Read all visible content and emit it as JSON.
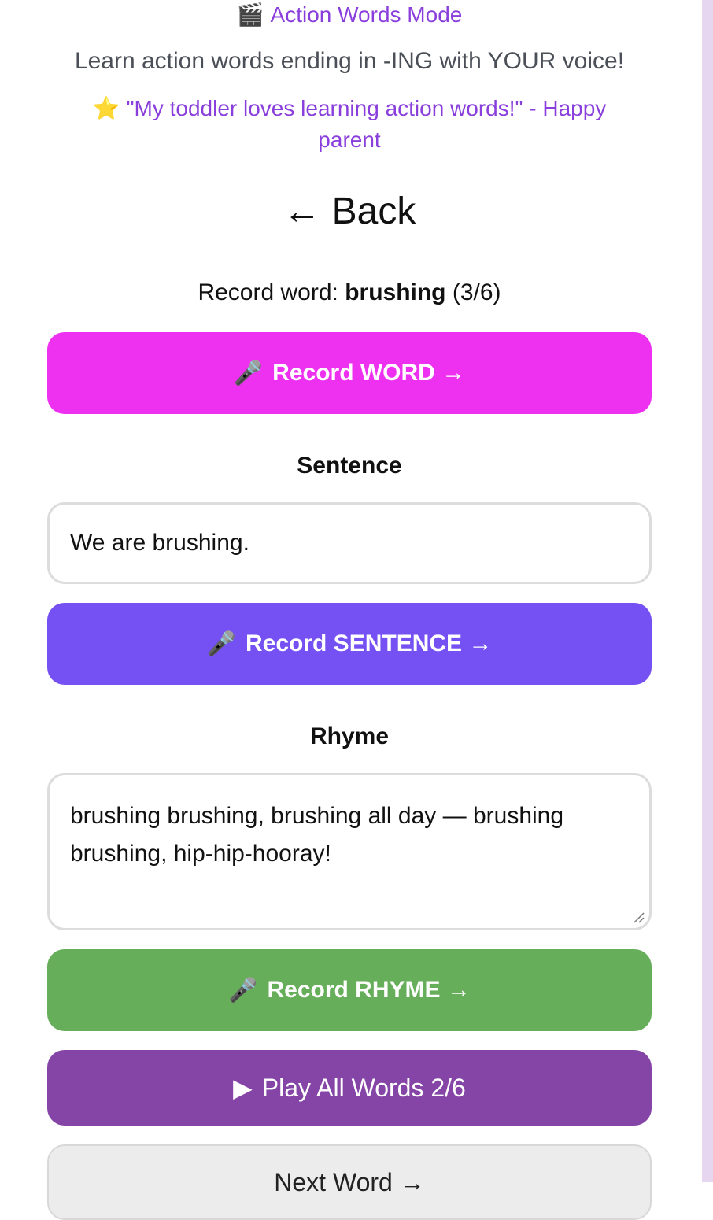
{
  "header": {
    "mode_icon": "clapper-board-emoji",
    "mode_emoji": "🎬",
    "mode_title": "Action Words Mode",
    "subtitle": "Learn action words ending in -ING with YOUR voice!",
    "testimonial_icon": "star-emoji",
    "testimonial_emoji": "⭐",
    "testimonial": "\"My toddler loves learning action words!\" - Happy parent"
  },
  "nav": {
    "back_arrow": "←",
    "back_label": "Back"
  },
  "progress": {
    "prefix": "Record word:",
    "word": "brushing",
    "count": "(3/6)"
  },
  "buttons": {
    "mic_emoji": "🎤",
    "record_word": "Record WORD →",
    "record_sentence": "Record SENTENCE →",
    "record_rhyme": "Record RHYME →",
    "play_icon": "▶",
    "play_all": "Play All Words 2/6",
    "next_word": "Next Word →"
  },
  "sentence": {
    "label": "Sentence",
    "value": "We are brushing."
  },
  "rhyme": {
    "label": "Rhyme",
    "value": "brushing brushing, brushing all day — brushing brushing, hip-hip-hooray!"
  },
  "colors": {
    "accent_purple_text": "#8a3fdc",
    "record_word_bg": "#ee31f1",
    "record_sentence_bg": "#7550f3",
    "record_rhyme_bg": "#67ae5b",
    "play_all_bg": "#8545a7",
    "next_word_bg": "#ececec"
  }
}
